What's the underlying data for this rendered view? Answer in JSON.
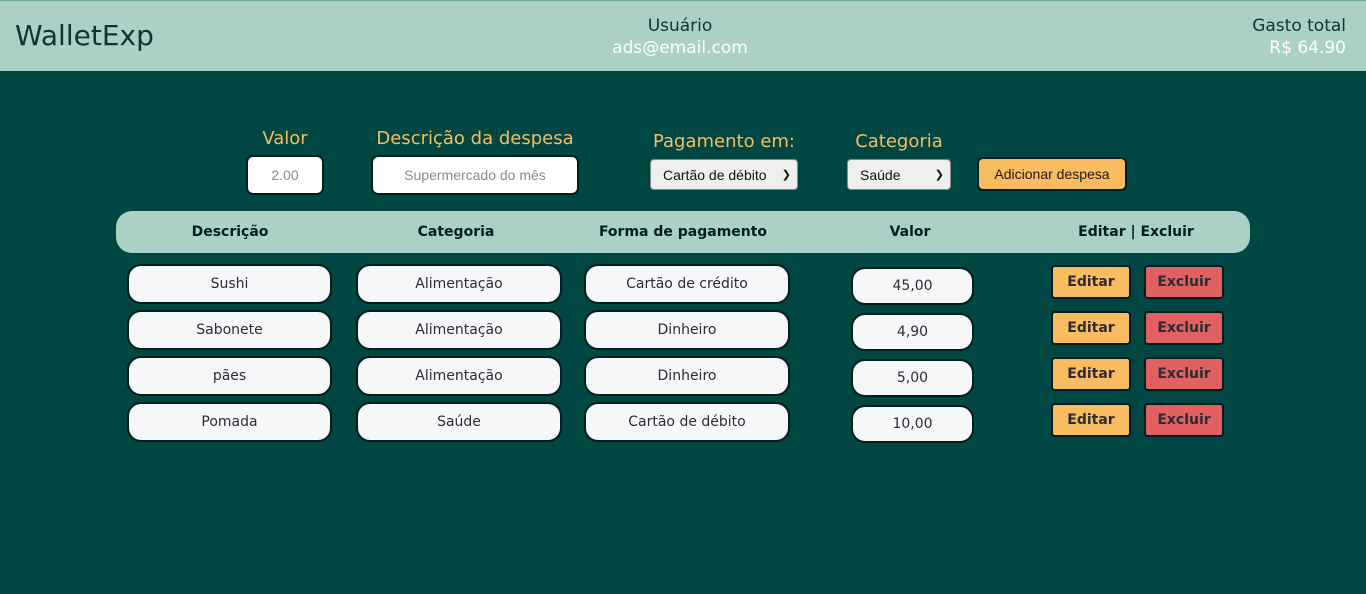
{
  "header": {
    "logo": "WalletExp",
    "user_title": "Usuário",
    "user_email": "ads@email.com",
    "total_title": "Gasto total",
    "total_value": "R$ 64.90"
  },
  "form": {
    "valor_label": "Valor",
    "valor_value": "2.00",
    "descricao_label": "Descrição da despesa",
    "descricao_placeholder": "Supermercado do mês",
    "pagamento_label": "Pagamento em:",
    "pagamento_value": "Cartão de débito",
    "categoria_label": "Categoria",
    "categoria_value": "Saúde",
    "add_button": "Adicionar despesa"
  },
  "table": {
    "headers": [
      "Descrição",
      "Categoria",
      "Forma de pagamento",
      "Valor",
      "Editar | Excluir"
    ],
    "rows": [
      {
        "descricao": "Sushi",
        "categoria": "Alimentação",
        "pagamento": "Cartão de crédito",
        "valor": "45,00"
      },
      {
        "descricao": "Sabonete",
        "categoria": "Alimentação",
        "pagamento": "Dinheiro",
        "valor": "4,90"
      },
      {
        "descricao": "pães",
        "categoria": "Alimentação",
        "pagamento": "Dinheiro",
        "valor": "5,00"
      },
      {
        "descricao": "Pomada",
        "categoria": "Saúde",
        "pagamento": "Cartão de débito",
        "valor": "10,00"
      }
    ],
    "edit_label": "Editar",
    "delete_label": "Excluir"
  },
  "colors": {
    "background": "#004643",
    "header": "#abd1c6",
    "accent": "#f9bc60",
    "danger": "#e16162"
  }
}
